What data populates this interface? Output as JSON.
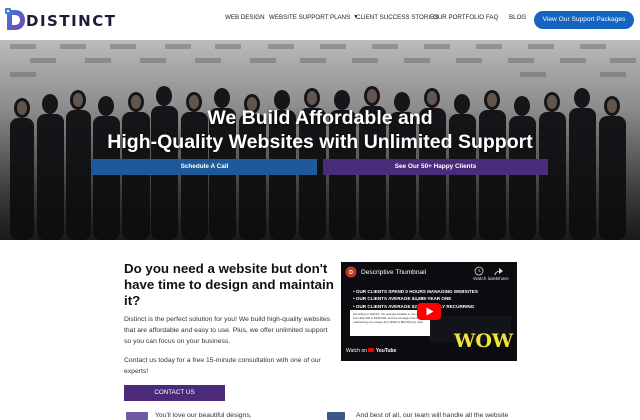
{
  "brand": {
    "name": "DISTINCT",
    "accent": "#1565c0",
    "purple": "#4b2a7b"
  },
  "nav": {
    "items": [
      {
        "label": "WEB DESIGN",
        "has_dropdown": false
      },
      {
        "label": "WEBSITE SUPPORT PLANS",
        "has_dropdown": true
      },
      {
        "label": "CLIENT SUCCESS STORIES",
        "has_dropdown": false
      },
      {
        "label": "OUR PORTFOLIO",
        "has_dropdown": false
      },
      {
        "label": "FAQ",
        "has_dropdown": false
      },
      {
        "label": "BLOG",
        "has_dropdown": false
      }
    ],
    "cta_label": "View Our Support Packages",
    "dropdown_icon": "chevron-down-icon"
  },
  "hero": {
    "title_line1": "We Build Affordable and",
    "title_line2": "High-Quality Websites with Unlimited Support",
    "primary_button": "Schedule A Call",
    "secondary_button": "See Our 50+ Happy Clients"
  },
  "intro": {
    "heading": "Do you need a website but don't have time to design and maintain it?",
    "body": "Distinct is the perfect solution for you! We build high-quality websites that are affordable and easy to use. Plus, we offer unlimited support so you can focus on your business.",
    "body2": "Contact us today for a free 15-minute consultation with one of our experts!",
    "button": "CONTACT US"
  },
  "video": {
    "title": "Descriptive Thumbnail",
    "watch_later": "Watch later",
    "share": "Share",
    "lines": [
      "• OUR CLIENTS SPEND 0 HOURS MANAGING WEBSITES",
      "• OUR CLIENTS AVERAGE $4,888-YEAR ONE",
      "• OUR CLIENTS AVERAGE $2,388 YEARLY RECURRING"
    ],
    "note": "According to WebFX, the average website in one ranges from $12,000 to $150,000, and the average cost of maintaining one ranges from $400 to $60,000 per year.",
    "overlay_text": "WOW",
    "watch_on": "Watch on",
    "platform": "YouTube",
    "play_icon": "play-icon"
  },
  "features": {
    "first": "You'll love our beautiful designs,",
    "second": "And best of all, our team will handle all the website"
  }
}
